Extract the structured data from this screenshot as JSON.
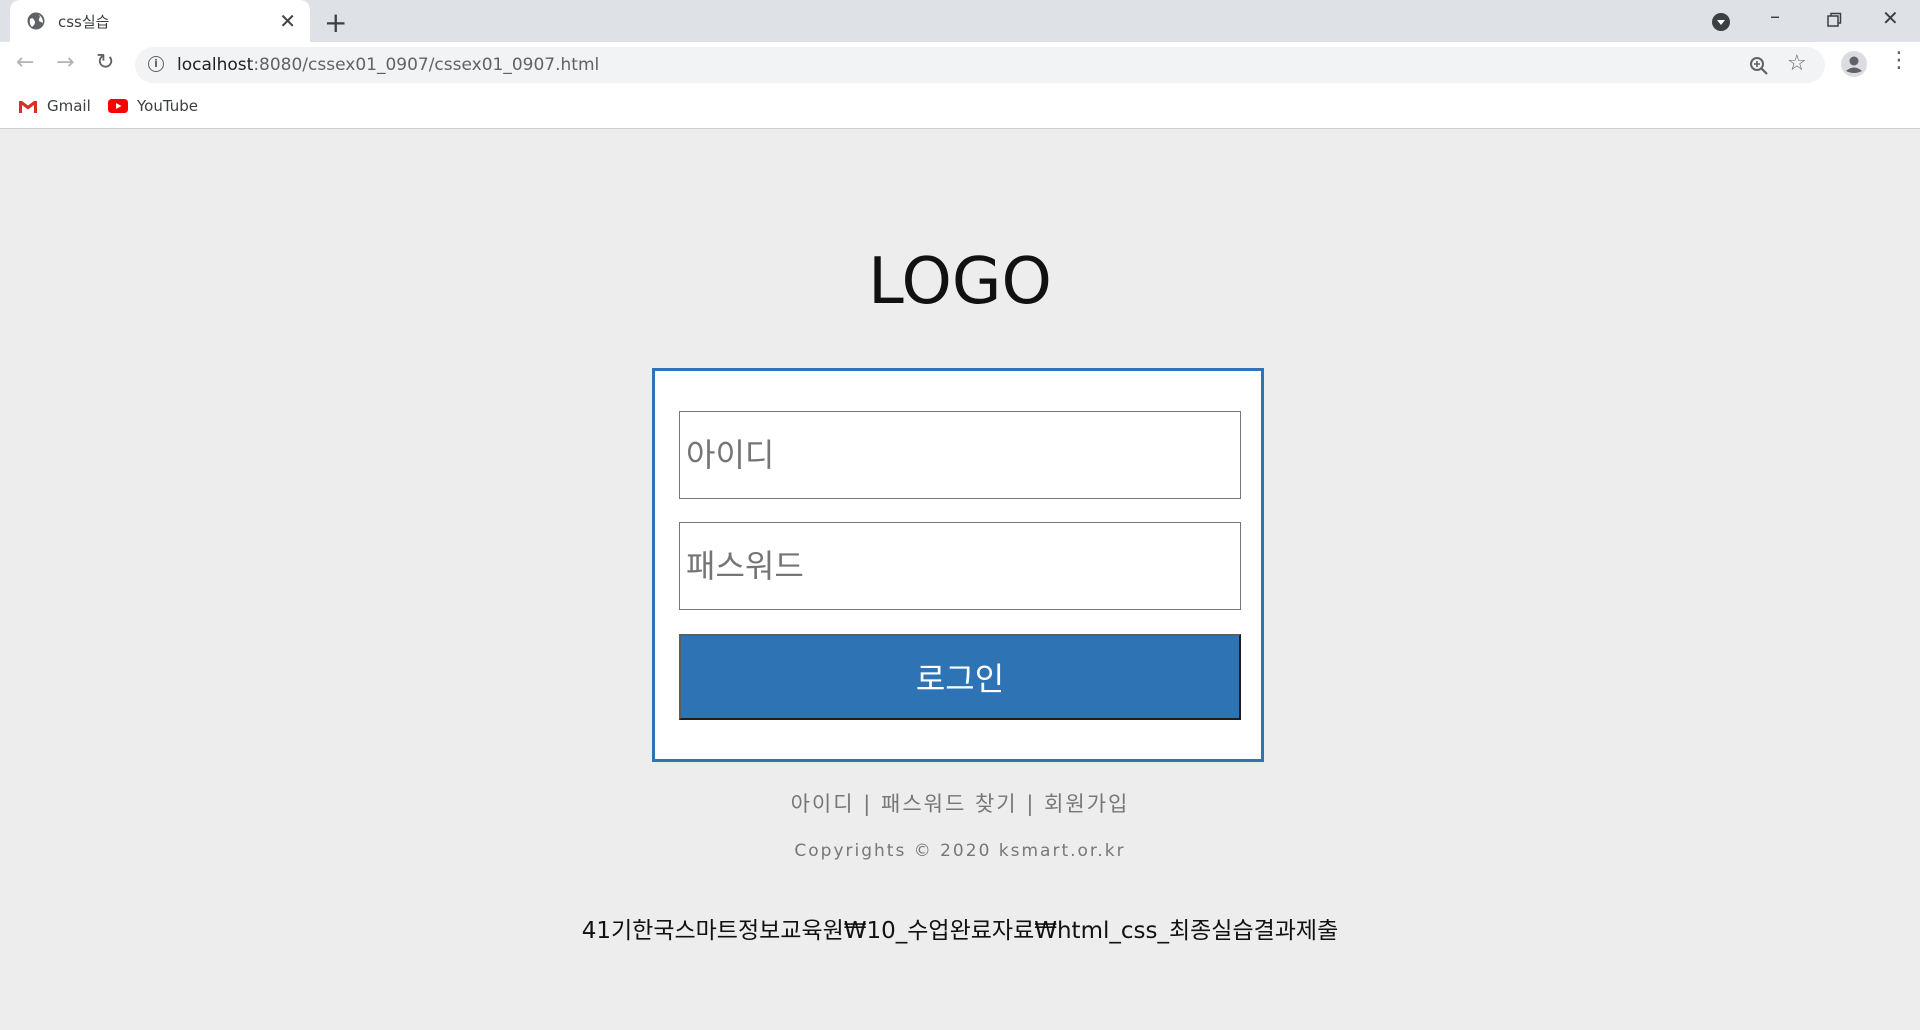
{
  "browser": {
    "tab_title": "css실습",
    "url_host": "localhost",
    "url_rest": ":8080/cssex01_0907/cssex01_0907.html",
    "bookmarks": [
      {
        "label": "Gmail",
        "icon": "gmail-icon"
      },
      {
        "label": "YouTube",
        "icon": "youtube-icon"
      }
    ]
  },
  "page": {
    "logo": "LOGO",
    "id_placeholder": "아이디",
    "pw_placeholder": "패스워드",
    "login_label": "로그인",
    "links": {
      "id": "아이디",
      "sep1": "|",
      "pw_find": "패스워드 찾기",
      "sep2": "|",
      "signup": "회원가입"
    },
    "copyright": "Copyrights © 2020 ksmart.or.kr",
    "footer_path": "41기한국스마트정보교육원₩10_수업완료자료₩html_css_최종실습결과제출"
  },
  "colors": {
    "accent": "#2e74b5",
    "page_bg": "#ededed"
  }
}
